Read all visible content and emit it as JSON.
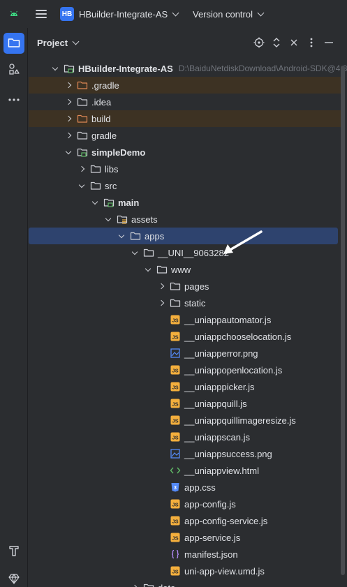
{
  "titlebar": {
    "android_icon": "android-icon",
    "menu_icon": "hamburger-menu-icon",
    "project_badge": "HB",
    "project_name": "HBuilder-Integrate-AS",
    "vcs_label": "Version control"
  },
  "toolstrip": {
    "top": [
      "folder-icon",
      "structure-icon",
      "more-icon"
    ],
    "bottom": [
      "build-hammer-icon",
      "gem-icon"
    ],
    "accent": "#3574f0"
  },
  "panel": {
    "title": "Project",
    "header_icons": [
      "locate-icon",
      "expand-collapse-icon",
      "close-all-icon",
      "options-icon",
      "hide-icon"
    ]
  },
  "tree": [
    {
      "label": "HBuilder-Integrate-AS",
      "path": "D:\\BaiduNetdiskDownload\\Android-SDK@4.8",
      "depth": 0,
      "expanded": true,
      "icon": "module",
      "bold": true
    },
    {
      "label": ".gradle",
      "depth": 1,
      "expanded": false,
      "icon": "folder-excluded",
      "excluded": true
    },
    {
      "label": ".idea",
      "depth": 1,
      "expanded": false,
      "icon": "folder"
    },
    {
      "label": "build",
      "depth": 1,
      "expanded": false,
      "icon": "folder-excluded",
      "excluded": true
    },
    {
      "label": "gradle",
      "depth": 1,
      "expanded": false,
      "icon": "folder"
    },
    {
      "label": "simpleDemo",
      "depth": 1,
      "expanded": true,
      "icon": "module",
      "bold": true
    },
    {
      "label": "libs",
      "depth": 2,
      "expanded": false,
      "icon": "folder"
    },
    {
      "label": "src",
      "depth": 2,
      "expanded": true,
      "icon": "folder"
    },
    {
      "label": "main",
      "depth": 3,
      "expanded": true,
      "icon": "module",
      "bold": true
    },
    {
      "label": "assets",
      "depth": 4,
      "expanded": true,
      "icon": "folder-resources"
    },
    {
      "label": "apps",
      "depth": 5,
      "expanded": true,
      "icon": "folder",
      "selected": true
    },
    {
      "label": "__UNI__9063282",
      "depth": 6,
      "expanded": true,
      "icon": "folder"
    },
    {
      "label": "www",
      "depth": 7,
      "expanded": true,
      "icon": "folder"
    },
    {
      "label": "pages",
      "depth": 8,
      "expanded": false,
      "icon": "folder"
    },
    {
      "label": "static",
      "depth": 8,
      "expanded": false,
      "icon": "folder"
    },
    {
      "label": "__uniappautomator.js",
      "depth": 8,
      "leaf": true,
      "icon": "js"
    },
    {
      "label": "__uniappchooselocation.js",
      "depth": 8,
      "leaf": true,
      "icon": "js"
    },
    {
      "label": "__uniapperror.png",
      "depth": 8,
      "leaf": true,
      "icon": "image"
    },
    {
      "label": "__uniappopenlocation.js",
      "depth": 8,
      "leaf": true,
      "icon": "js"
    },
    {
      "label": "__uniapppicker.js",
      "depth": 8,
      "leaf": true,
      "icon": "js"
    },
    {
      "label": "__uniappquill.js",
      "depth": 8,
      "leaf": true,
      "icon": "js"
    },
    {
      "label": "__uniappquillimageresize.js",
      "depth": 8,
      "leaf": true,
      "icon": "js"
    },
    {
      "label": "__uniappscan.js",
      "depth": 8,
      "leaf": true,
      "icon": "js"
    },
    {
      "label": "__uniappsuccess.png",
      "depth": 8,
      "leaf": true,
      "icon": "image"
    },
    {
      "label": "__uniappview.html",
      "depth": 8,
      "leaf": true,
      "icon": "html"
    },
    {
      "label": "app.css",
      "depth": 8,
      "leaf": true,
      "icon": "css"
    },
    {
      "label": "app-config.js",
      "depth": 8,
      "leaf": true,
      "icon": "js"
    },
    {
      "label": "app-config-service.js",
      "depth": 8,
      "leaf": true,
      "icon": "js"
    },
    {
      "label": "app-service.js",
      "depth": 8,
      "leaf": true,
      "icon": "js"
    },
    {
      "label": "manifest.json",
      "depth": 8,
      "leaf": true,
      "icon": "json"
    },
    {
      "label": "uni-app-view.umd.js",
      "depth": 8,
      "leaf": true,
      "icon": "js"
    },
    {
      "label": "data",
      "depth": 6,
      "expanded": false,
      "icon": "folder"
    }
  ],
  "annotation": {
    "icon": "pointer-arrow-icon",
    "color": "#ffffff"
  }
}
